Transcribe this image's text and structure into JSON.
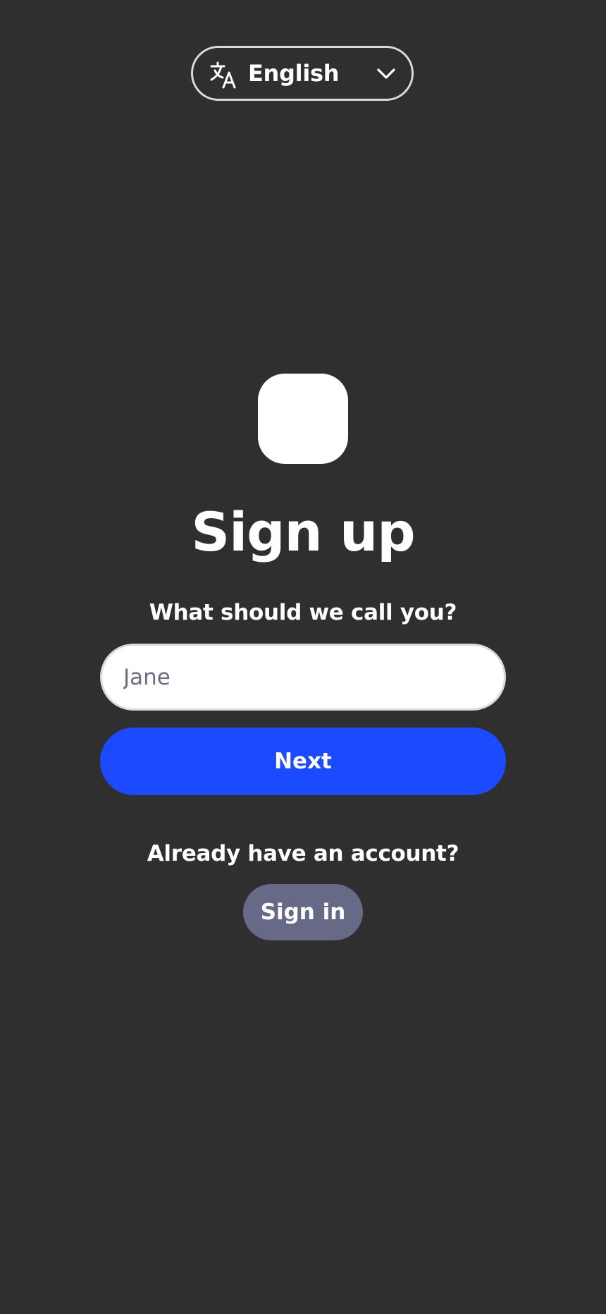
{
  "language_selector": {
    "icon": "translate-icon",
    "selected": "English",
    "chevron_icon": "chevron-down-icon"
  },
  "logo": {
    "icon": "app-logo",
    "color": "#ffffff"
  },
  "page": {
    "title": "Sign up",
    "prompt": "What should we call you?"
  },
  "name_field": {
    "placeholder": "Jane",
    "value": ""
  },
  "next_button": {
    "label": "Next",
    "color": "#1c4bff"
  },
  "sign_in": {
    "prompt": "Already have an account?",
    "button_label": "Sign in",
    "button_color": "#676a87"
  },
  "colors": {
    "background": "#2f2f2f",
    "text": "#ffffff",
    "border": "#d9d9e3"
  }
}
